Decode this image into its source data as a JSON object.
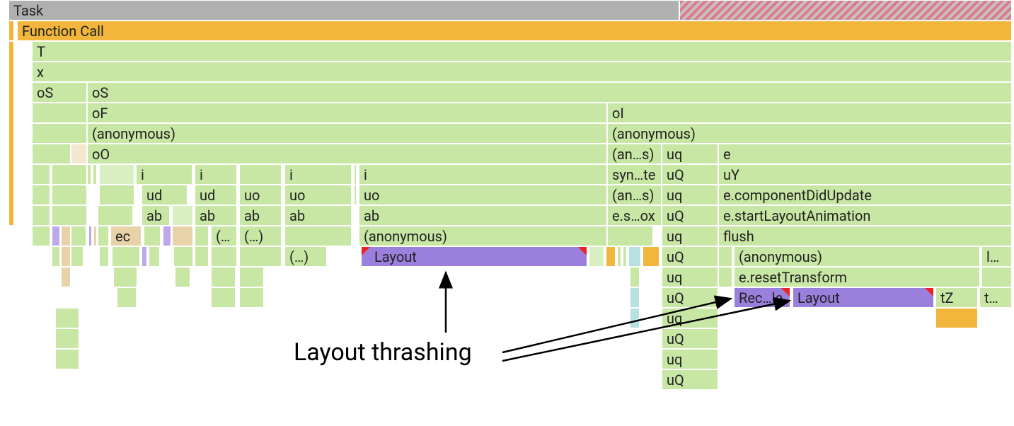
{
  "rows": {
    "task_label": "Task",
    "function_call_label": "Function Call",
    "r2": {
      "a": "T"
    },
    "r3": {
      "a": "x"
    },
    "r4": {
      "a": "oS",
      "b": "oS"
    },
    "r5": {
      "a": "oF",
      "b": "oI"
    },
    "r6": {
      "a": "(anonymous)",
      "b": "(anonymous)"
    },
    "r7": {
      "a": "oO",
      "b": "(an…s)",
      "c": "uq",
      "d": "e"
    },
    "r8": {
      "a": "i",
      "b": "i",
      "c": "i",
      "d": "i",
      "e": "syn…te",
      "f": "uQ",
      "g": "uY"
    },
    "r9": {
      "a": "ud",
      "b": "ud",
      "c": "uo",
      "d": "uo",
      "e": "uo",
      "f": "(an…s)",
      "g": "uq",
      "h": "e.componentDidUpdate"
    },
    "r10": {
      "a": "ab",
      "b": "ab",
      "c": "ab",
      "d": "ab",
      "e": "ab",
      "f": "e.s…ox",
      "g": "uQ",
      "h": "e.startLayoutAnimation"
    },
    "r11": {
      "a": "ec",
      "b": "(…",
      "c": "(…)",
      "d": "(anonymous)",
      "e": "uq",
      "f": "flush"
    },
    "r12": {
      "a": "(…)",
      "b": "Layout",
      "c": "uQ",
      "d": "(anonymous)",
      "e": "l…"
    },
    "r13": {
      "a": "uq",
      "b": "e.resetTransform"
    },
    "r14": {
      "a": "uQ",
      "b": "Rec…le",
      "c": "Layout",
      "d": "tZ",
      "e": "t…"
    },
    "r15": {
      "a": "uq"
    },
    "r16": {
      "a": "uQ"
    },
    "r17": {
      "a": "uq"
    },
    "r18": {
      "a": "uQ"
    }
  },
  "annotation": {
    "text": "Layout thrashing"
  },
  "colors": {
    "task": "#b0b0b0",
    "script": "#f2b63c",
    "js": "#c8e6a4",
    "layout": "#9a7fdc"
  },
  "gridlines_x": [
    122,
    330,
    513,
    693,
    878,
    1060,
    1243
  ]
}
